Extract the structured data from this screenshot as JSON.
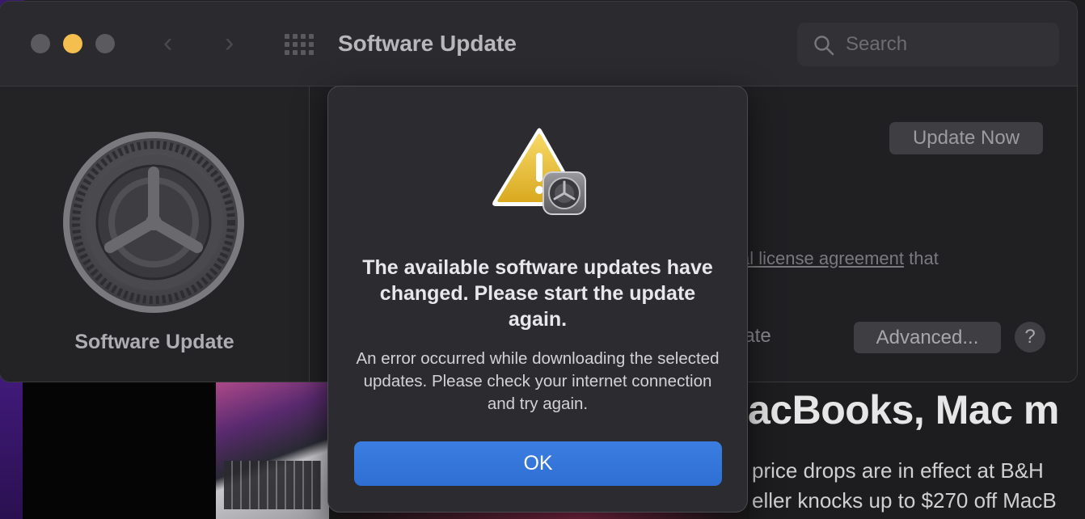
{
  "window": {
    "title": "Software Update",
    "search_placeholder": "Search"
  },
  "sidebar": {
    "label": "Software Update"
  },
  "content": {
    "update_now_label": "Update Now",
    "license_link_text": "al license agreement",
    "license_suffix": " that",
    "auto_update_fragment": "late",
    "advanced_label": "Advanced...",
    "help_label": "?"
  },
  "dialog": {
    "title": "The available software updates have changed. Please start the update again.",
    "message": "An error occurred while downloading the selected updates. Please check your internet connection and try again.",
    "ok_label": "OK"
  },
  "background_page": {
    "headline": "acBooks, Mac m",
    "text_line1": "price drops are in effect at B&H",
    "text_line2": "eller knocks up to $270 off MacB"
  },
  "colors": {
    "traffic_close": "#5b5a5f",
    "traffic_minimize": "#f4bf4f",
    "traffic_zoom": "#5b5a5f",
    "accent_button": "#2f6fd4",
    "warning_yellow": "#f2c53d"
  },
  "icons": [
    "back-chevron-icon",
    "forward-chevron-icon",
    "grid-icon",
    "search-icon",
    "gear-icon",
    "warning-icon"
  ]
}
